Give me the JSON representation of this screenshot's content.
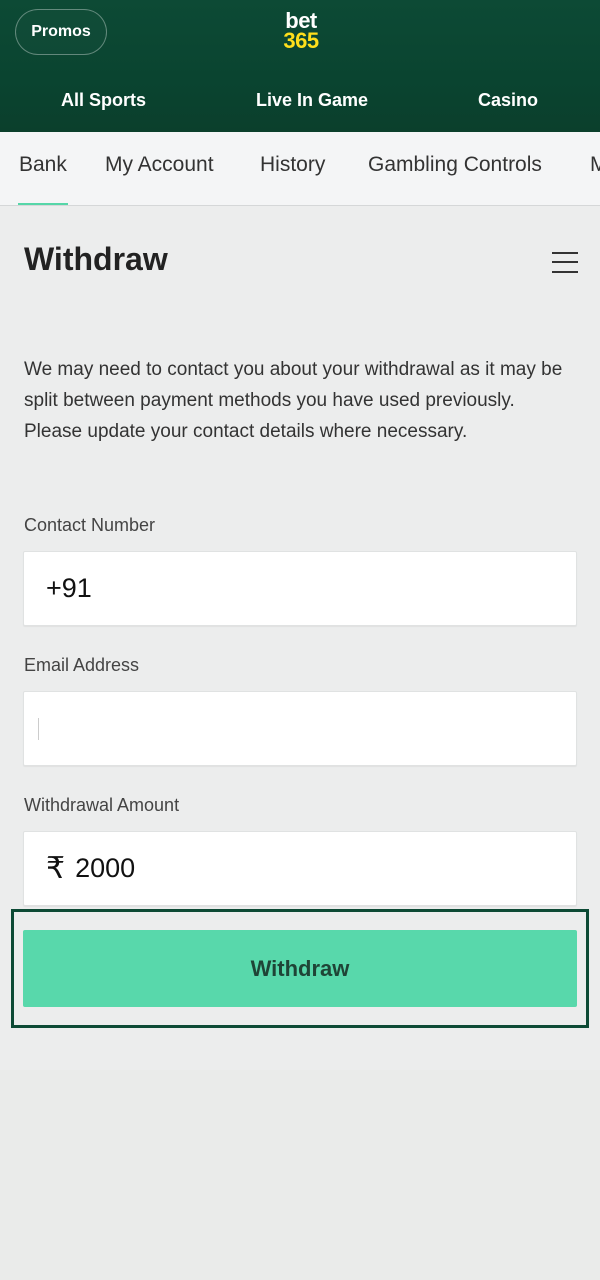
{
  "header": {
    "promos_label": "Promos",
    "logo_top": "bet",
    "logo_bottom": "365",
    "nav": [
      "All Sports",
      "Live In Game",
      "Casino"
    ]
  },
  "subnav": {
    "tabs": [
      "Bank",
      "My Account",
      "History",
      "Gambling Controls",
      "M"
    ],
    "active": "Bank"
  },
  "page": {
    "title": "Withdraw",
    "info": "We may need to contact you about your withdrawal as it may be split between payment methods you have used previously. Please update your contact details where necessary."
  },
  "form": {
    "contact_label": "Contact Number",
    "contact_value": "+91",
    "email_label": "Email Address",
    "email_value": "",
    "amount_label": "Withdrawal Amount",
    "amount_currency": "₹",
    "amount_value": "2000",
    "submit_label": "Withdraw"
  },
  "colors": {
    "header_green": "#0d4a35",
    "accent_green": "#58d8ab",
    "logo_yellow": "#ffdf1b"
  },
  "icons": {
    "menu": "hamburger-menu-icon"
  }
}
